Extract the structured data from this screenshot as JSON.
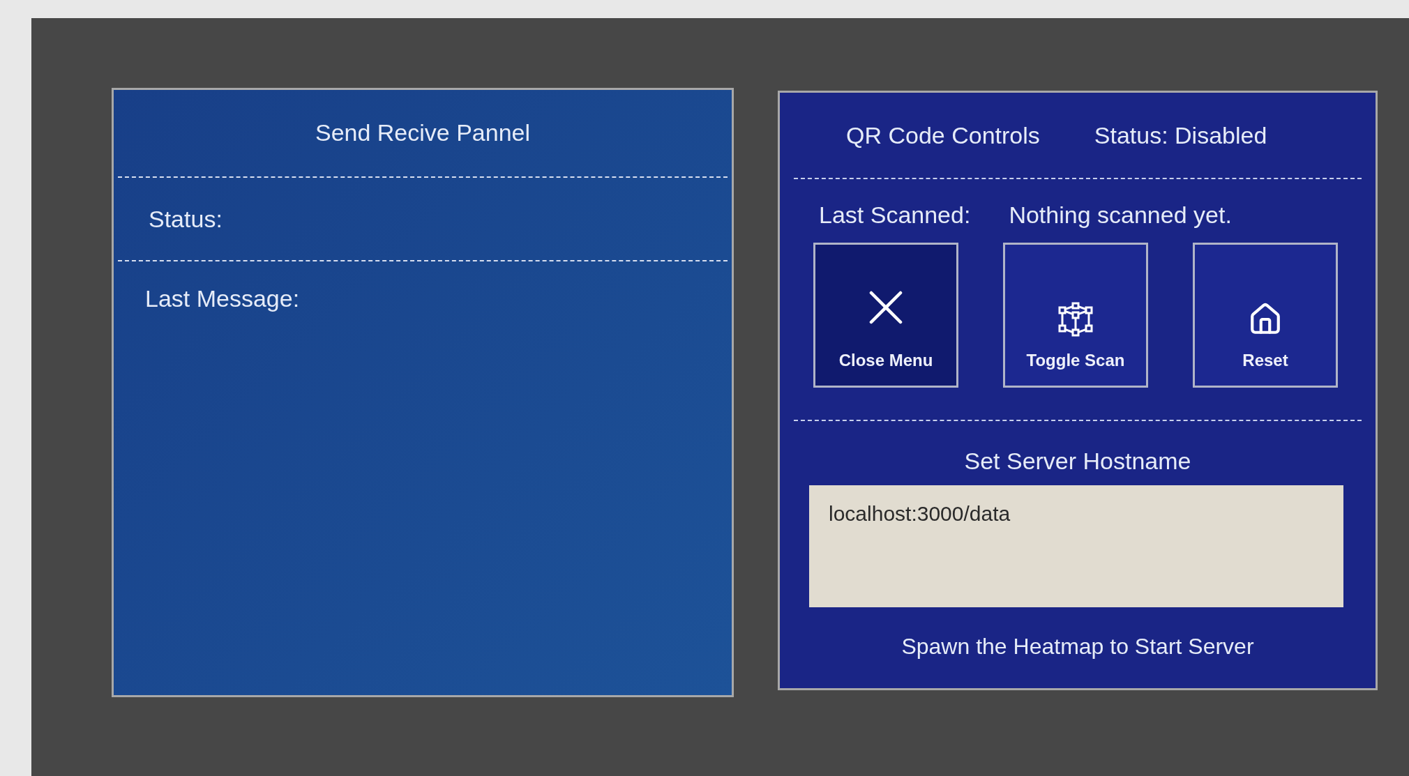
{
  "send_receive_panel": {
    "title": "Send Recive Pannel",
    "status_label": "Status:",
    "last_message_label": "Last Message:"
  },
  "qr_panel": {
    "title": "QR Code Controls",
    "status": "Status: Disabled",
    "last_scanned_label": "Last Scanned:",
    "last_scanned_value": "Nothing scanned yet.",
    "buttons": [
      {
        "kind": "close",
        "label": "Close Menu",
        "highlighted": true
      },
      {
        "kind": "scan",
        "label": "Toggle Scan",
        "highlighted": false
      },
      {
        "kind": "home",
        "label": "Reset",
        "highlighted": false
      }
    ],
    "hostname_heading": "Set Server Hostname",
    "hostname_value": "localhost:3000/data",
    "footer": "Spawn the Heatmap to Start Server"
  }
}
